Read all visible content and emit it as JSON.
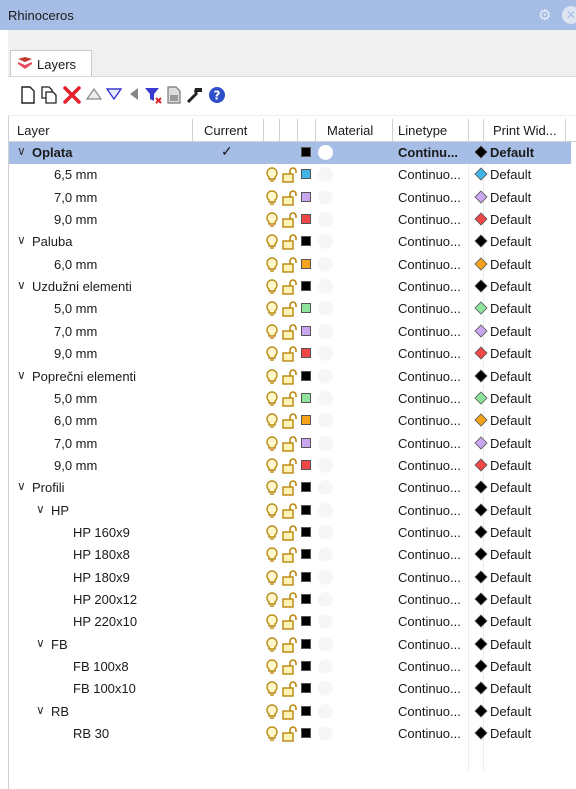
{
  "window": {
    "title": "Rhinoceros"
  },
  "tab": {
    "label": "Layers"
  },
  "toolbar_icons": [
    "new-layer-icon",
    "new-sublayer-icon",
    "delete-icon",
    "move-up-icon",
    "move-down-icon",
    "move-out-icon",
    "filter-icon",
    "layer-panel-icon",
    "tools-icon",
    "help-icon"
  ],
  "columns": [
    "Layer",
    "Current",
    "Material",
    "Linetype",
    "Print Wid..."
  ],
  "colors": {
    "title_bar": "#a6bde6",
    "selected_row": "#a6bde6"
  },
  "rows": [
    {
      "name": "Oplata",
      "depth": 0,
      "expanded": true,
      "current": true,
      "color": "#000000",
      "linetype": "Continu...",
      "print_width": "Default",
      "diamond": "#000000"
    },
    {
      "name": "6,5 mm",
      "depth": 1,
      "color": "#41b6e6",
      "linetype": "Continuo...",
      "print_width": "Default",
      "diamond": "#41b6e6"
    },
    {
      "name": "7,0 mm",
      "depth": 1,
      "color": "#c9a7f0",
      "linetype": "Continuo...",
      "print_width": "Default",
      "diamond": "#c9a7f0"
    },
    {
      "name": "9,0 mm",
      "depth": 1,
      "color": "#f04848",
      "linetype": "Continuo...",
      "print_width": "Default",
      "diamond": "#f04848"
    },
    {
      "name": "Paluba",
      "depth": 0,
      "expanded": true,
      "color": "#000000",
      "linetype": "Continuo...",
      "print_width": "Default",
      "diamond": "#000000"
    },
    {
      "name": "6,0 mm",
      "depth": 1,
      "color": "#f5a31a",
      "linetype": "Continuo...",
      "print_width": "Default",
      "diamond": "#f5a31a"
    },
    {
      "name": "Uzdužni elementi",
      "depth": 0,
      "expanded": true,
      "color": "#000000",
      "linetype": "Continuo...",
      "print_width": "Default",
      "diamond": "#000000"
    },
    {
      "name": "5,0 mm",
      "depth": 1,
      "color": "#8ee39a",
      "linetype": "Continuo...",
      "print_width": "Default",
      "diamond": "#8ee39a"
    },
    {
      "name": "7,0 mm",
      "depth": 1,
      "color": "#c9a7f0",
      "linetype": "Continuo...",
      "print_width": "Default",
      "diamond": "#c9a7f0"
    },
    {
      "name": "9,0 mm",
      "depth": 1,
      "color": "#f04848",
      "linetype": "Continuo...",
      "print_width": "Default",
      "diamond": "#f04848"
    },
    {
      "name": "Poprečni elementi",
      "depth": 0,
      "expanded": true,
      "color": "#000000",
      "linetype": "Continuo...",
      "print_width": "Default",
      "diamond": "#000000"
    },
    {
      "name": "5,0 mm",
      "depth": 1,
      "color": "#8ee39a",
      "linetype": "Continuo...",
      "print_width": "Default",
      "diamond": "#8ee39a"
    },
    {
      "name": "6,0 mm",
      "depth": 1,
      "color": "#f5a31a",
      "linetype": "Continuo...",
      "print_width": "Default",
      "diamond": "#f5a31a"
    },
    {
      "name": "7,0 mm",
      "depth": 1,
      "color": "#c9a7f0",
      "linetype": "Continuo...",
      "print_width": "Default",
      "diamond": "#c9a7f0"
    },
    {
      "name": "9,0 mm",
      "depth": 1,
      "color": "#f04848",
      "linetype": "Continuo...",
      "print_width": "Default",
      "diamond": "#f04848"
    },
    {
      "name": "Profili",
      "depth": 0,
      "expanded": true,
      "color": "#000000",
      "linetype": "Continuo...",
      "print_width": "Default",
      "diamond": "#000000"
    },
    {
      "name": "HP",
      "depth": 1,
      "expanded": true,
      "color": "#000000",
      "linetype": "Continuo...",
      "print_width": "Default",
      "diamond": "#000000"
    },
    {
      "name": "HP 160x9",
      "depth": 2,
      "color": "#000000",
      "linetype": "Continuo...",
      "print_width": "Default",
      "diamond": "#000000"
    },
    {
      "name": "HP 180x8",
      "depth": 2,
      "color": "#000000",
      "linetype": "Continuo...",
      "print_width": "Default",
      "diamond": "#000000"
    },
    {
      "name": "HP 180x9",
      "depth": 2,
      "color": "#000000",
      "linetype": "Continuo...",
      "print_width": "Default",
      "diamond": "#000000"
    },
    {
      "name": "HP 200x12",
      "depth": 2,
      "color": "#000000",
      "linetype": "Continuo...",
      "print_width": "Default",
      "diamond": "#000000"
    },
    {
      "name": "HP 220x10",
      "depth": 2,
      "color": "#000000",
      "linetype": "Continuo...",
      "print_width": "Default",
      "diamond": "#000000"
    },
    {
      "name": "FB",
      "depth": 1,
      "expanded": true,
      "color": "#000000",
      "linetype": "Continuo...",
      "print_width": "Default",
      "diamond": "#000000"
    },
    {
      "name": "FB 100x8",
      "depth": 2,
      "color": "#000000",
      "linetype": "Continuo...",
      "print_width": "Default",
      "diamond": "#000000"
    },
    {
      "name": "FB 100x10",
      "depth": 2,
      "color": "#000000",
      "linetype": "Continuo...",
      "print_width": "Default",
      "diamond": "#000000"
    },
    {
      "name": "RB",
      "depth": 1,
      "expanded": true,
      "color": "#000000",
      "linetype": "Continuo...",
      "print_width": "Default",
      "diamond": "#000000"
    },
    {
      "name": "RB 30",
      "depth": 2,
      "color": "#000000",
      "linetype": "Continuo...",
      "print_width": "Default",
      "diamond": "#000000"
    }
  ]
}
